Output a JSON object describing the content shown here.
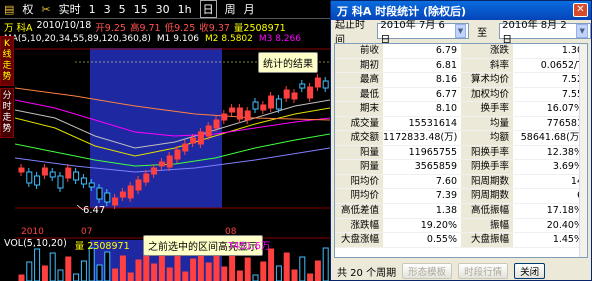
{
  "toolbar": {
    "items": [
      "权",
      "实时",
      "1",
      "3",
      "5",
      "15",
      "30",
      "1h",
      "日",
      "周",
      "月"
    ],
    "active": "日"
  },
  "info": {
    "name": "万 科A",
    "date": "2010/10/18",
    "open": "开9.25",
    "high": "高9.71",
    "low": "低9.25",
    "close": "收9.37",
    "volume": "量2508971"
  },
  "ma": {
    "label": "MA(5,10,20,34,55,89,120,360,8)",
    "m1": "M1 9.106",
    "m2": "M2 8.5802",
    "m3": "M3 8.266"
  },
  "sidetabs": [
    "K线走势",
    "分时走势"
  ],
  "chart": {
    "low_label": "6.47",
    "x_labels": [
      "2010",
      "07",
      "08"
    ],
    "colors": {
      "up": "#ff4040",
      "down": "#40c0ff",
      "highlight": "#1e28a0"
    }
  },
  "callouts": {
    "result": "统计的结果",
    "range": "之前选中的区间高亮显示"
  },
  "volbar": {
    "label": "VOL(5,10,20)",
    "value": "量 2508971",
    "right": "7451.6万"
  },
  "dialog": {
    "title": "万 科A 时段统计 (除权后)",
    "start_label": "起止时间",
    "start_date": "2010年 7月 6日",
    "to_label": "至",
    "end_date": "2010年 8月 2日",
    "rows": [
      [
        "前收",
        "6.79",
        "涨跌",
        "1.30"
      ],
      [
        "期初",
        "6.81",
        "斜率",
        "0.0652/T"
      ],
      [
        "最高",
        "8.16",
        "算术均价",
        "7.52"
      ],
      [
        "最低",
        "6.77",
        "加权均价",
        "7.55"
      ],
      [
        "期末",
        "8.10",
        "换手率",
        "16.07%"
      ],
      [
        "成交量",
        "15531614",
        "均量",
        "776581"
      ],
      [
        "成交额",
        "1172833.48(万)",
        "均额",
        "58641.68(万)"
      ],
      [
        "阳量",
        "11965755",
        "阳换手率",
        "12.38%"
      ],
      [
        "阴量",
        "3565859",
        "阴换手率",
        "3.69%"
      ],
      [
        "阳均价",
        "7.60",
        "阳周期数",
        "14"
      ],
      [
        "阴均价",
        "7.39",
        "阴周期数",
        "6"
      ],
      [
        "高低差值",
        "1.38",
        "高低振幅",
        "17.18%"
      ],
      [
        "涨跌幅",
        "19.20%",
        "振幅",
        "20.40%"
      ],
      [
        "大盘涨幅",
        "0.55%",
        "大盘振幅",
        "1.45%"
      ]
    ],
    "footer": {
      "count": "共 20 个周期",
      "btn_export": "形态模板",
      "btn_ticks": "时段行情",
      "btn_close": "关闭"
    }
  }
}
